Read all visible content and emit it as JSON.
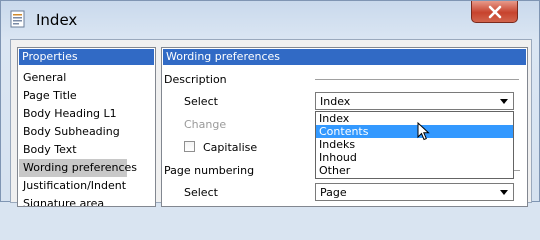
{
  "window": {
    "title": "Index"
  },
  "left_panel": {
    "header": "Properties",
    "items": [
      {
        "label": "General"
      },
      {
        "label": "Page Title"
      },
      {
        "label": "Body Heading L1"
      },
      {
        "label": "Body Subheading"
      },
      {
        "label": "Body Text"
      },
      {
        "label": "Wording preferences",
        "selected": true
      },
      {
        "label": "Justification/Indent"
      },
      {
        "label": "Signature area"
      }
    ]
  },
  "right_panel": {
    "header": "Wording preferences",
    "description_group": "Description",
    "select_label": "Select",
    "select_value": "Index",
    "change_label": "Change",
    "capitalise_label": "Capitalise",
    "dropdown_options": [
      "Index",
      "Contents",
      "Indeks",
      "Inhoud",
      "Other"
    ],
    "highlighted_option": "Contents",
    "page_numbering_group": "Page numbering",
    "page_select_label": "Select",
    "page_select_value": "Page"
  },
  "colors": {
    "header_blue": "#316ac5",
    "highlight_blue": "#3399ff",
    "close_red": "#c7432d"
  },
  "icons": [
    "app-document-icon",
    "close-icon",
    "dropdown-arrow-icon",
    "mouse-pointer-icon"
  ]
}
